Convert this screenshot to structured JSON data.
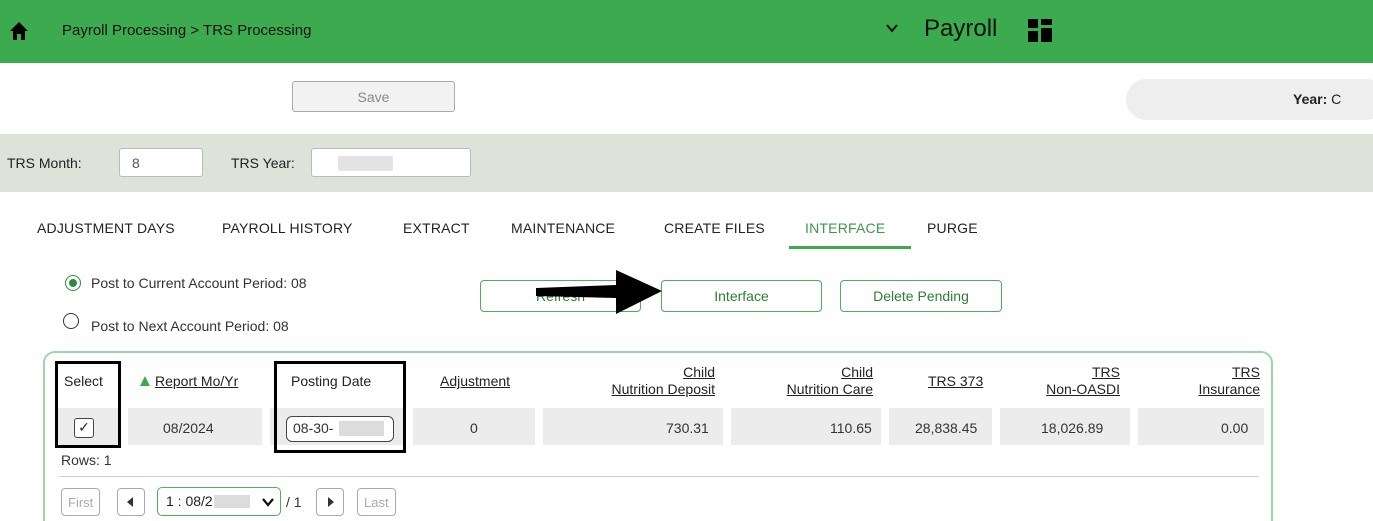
{
  "header": {
    "breadcrumb": "Payroll Processing > TRS Processing",
    "module": "Payroll"
  },
  "toolbar": {
    "save_label": "Save",
    "year_label": "Year:",
    "year_value": "C"
  },
  "filters": {
    "trs_month_label": "TRS Month:",
    "trs_month_value": "8",
    "trs_year_label": "TRS Year:"
  },
  "tabs": [
    {
      "label": "ADJUSTMENT DAYS"
    },
    {
      "label": "PAYROLL HISTORY"
    },
    {
      "label": "EXTRACT"
    },
    {
      "label": "MAINTENANCE"
    },
    {
      "label": "CREATE FILES"
    },
    {
      "label": "INTERFACE",
      "active": true
    },
    {
      "label": "PURGE"
    }
  ],
  "options": {
    "post_current": "Post to Current Account Period: 08",
    "post_next": "Post to Next Account Period: 08",
    "selected": "post_current"
  },
  "actions": {
    "refresh": "Refresh",
    "interface": "Interface",
    "delete_pending": "Delete Pending"
  },
  "grid": {
    "headers": {
      "select": "Select",
      "report": "Report Mo/Yr",
      "posting": "Posting Date",
      "adjustment": "Adjustment",
      "child_dep_1": "Child",
      "child_dep_2": "Nutrition Deposit",
      "child_care_1": "Child",
      "child_care_2": "Nutrition Care",
      "trs373": "TRS 373",
      "nonoasdi_1": "TRS",
      "nonoasdi_2": "Non-OASDI",
      "ins_1": "TRS",
      "ins_2": "Insurance"
    },
    "row": {
      "selected": "✓",
      "report": "08/2024",
      "posting": "08-30-",
      "adjustment": "0",
      "child_deposit": "730.31",
      "child_care": "110.65",
      "trs373": "28,838.45",
      "nonoasdi": "18,026.89",
      "insurance": "0.00"
    },
    "rows_label": "Rows: 1"
  },
  "pager": {
    "first": "First",
    "last": "Last",
    "page_select": "1 : 08/2",
    "of": "/ 1"
  },
  "colors": {
    "header_green": "#3cab4f",
    "filter_bg": "#dde3d9",
    "accent": "#2e7d32"
  }
}
